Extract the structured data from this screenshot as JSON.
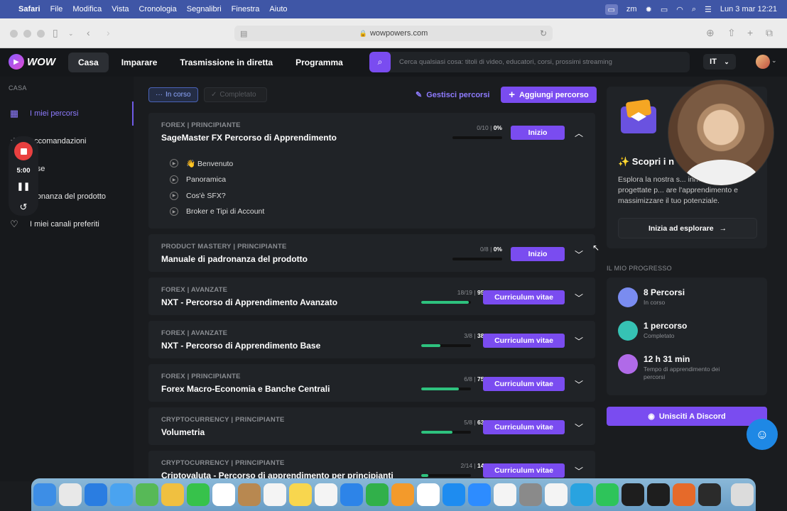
{
  "menubar": {
    "app": "Safari",
    "items": [
      "File",
      "Modifica",
      "Vista",
      "Cronologia",
      "Segnalibri",
      "Finestra",
      "Aiuto"
    ],
    "datetime": "Lun 3 mar  12:21"
  },
  "browser": {
    "url": "wowpowers.com"
  },
  "header": {
    "logo": "WOW",
    "nav": [
      "Casa",
      "Imparare",
      "Trasmissione in diretta",
      "Programma"
    ],
    "search_placeholder": "Cerca qualsiasi cosa: titoli di video, educatori, corsi, prossimi streaming",
    "language": "IT"
  },
  "sidebar": {
    "section": "CASA",
    "items": [
      {
        "label": "I miei percorsi",
        "icon": "paths-icon"
      },
      {
        "label": "accomandazioni",
        "icon": "star-icon"
      },
      {
        "label": "orse",
        "icon": "book-icon"
      },
      {
        "label": "dronanza del prodotto",
        "icon": "box-icon"
      },
      {
        "label": "I miei canali preferiti",
        "icon": "heart-icon"
      }
    ]
  },
  "recorder": {
    "time": "5:00"
  },
  "main": {
    "filters": [
      "In corso",
      "Completato"
    ],
    "manage": "Gestisci percorsi",
    "add": "Aggiungi percorso",
    "courses": [
      {
        "category": "FOREX | PRINCIPIANTE",
        "title": "SageMaster FX Percorso di Apprendimento",
        "done": "0/10",
        "percent": "0%",
        "progress": 0,
        "button": "Inizio",
        "expanded": true,
        "lessons": [
          "👋 Benvenuto",
          "Panoramica",
          "Cos'è SFX?",
          "Broker e Tipi di Account"
        ]
      },
      {
        "category": "PRODUCT MASTERY | PRINCIPIANTE",
        "title": "Manuale di padronanza del prodotto",
        "done": "0/8",
        "percent": "0%",
        "progress": 0,
        "button": "Inizio"
      },
      {
        "category": "FOREX | AVANZATE",
        "title": "NXT - Percorso di Apprendimento Avanzato",
        "done": "18/19",
        "percent": "95%",
        "progress": 95,
        "button": "Curriculum vitae"
      },
      {
        "category": "FOREX | AVANZATE",
        "title": "NXT - Percorso di Apprendimento Base",
        "done": "3/8",
        "percent": "38%",
        "progress": 38,
        "button": "Curriculum vitae"
      },
      {
        "category": "FOREX | PRINCIPIANTE",
        "title": "Forex Macro-Economia e Banche Centrali",
        "done": "6/8",
        "percent": "75%",
        "progress": 75,
        "button": "Curriculum vitae"
      },
      {
        "category": "CRYPTOCURRENCY | PRINCIPIANTE",
        "title": "Volumetria",
        "done": "5/8",
        "percent": "63%",
        "progress": 63,
        "button": "Curriculum vitae"
      },
      {
        "category": "CRYPTOCURRENCY | PRINCIPIANTE",
        "title": "Criptovaluta - Percorso di apprendimento per principianti",
        "done": "2/14",
        "percent": "14%",
        "progress": 14,
        "button": "Curriculum vitae"
      }
    ]
  },
  "right": {
    "discover_title": "✨ Scopri i n",
    "discover_desc": "Esplora la nostra s... innovative progettate p... are l'apprendimento e massimizzare il tuo potenziale.",
    "discover_cta": "Inizia ad esplorare",
    "progress_label": "IL MIO PROGRESSO",
    "stats": [
      {
        "value": "8 Percorsi",
        "label": "In corso",
        "color": "#7a8cf0"
      },
      {
        "value": "1 percorso",
        "label": "Completato",
        "color": "#36c2b4"
      },
      {
        "value": "12 h  31 min",
        "label": "Tempo di apprendimento dei percorsi",
        "color": "#b06ae8"
      }
    ],
    "discord": "Unisciti A Discord"
  },
  "dock": {
    "apps": [
      {
        "name": "Finder",
        "color": "#3d8ee6"
      },
      {
        "name": "Launchpad",
        "color": "#e8e8e8"
      },
      {
        "name": "Safari",
        "color": "#2a7de1"
      },
      {
        "name": "Mail",
        "color": "#4aa3f0"
      },
      {
        "name": "Maps",
        "color": "#57b957"
      },
      {
        "name": "Photos",
        "color": "#f0c040"
      },
      {
        "name": "FaceTime",
        "color": "#37c24b"
      },
      {
        "name": "Calendar",
        "color": "#ffffff"
      },
      {
        "name": "Contacts",
        "color": "#b88850"
      },
      {
        "name": "Reminders",
        "color": "#f4f4f4"
      },
      {
        "name": "Notes",
        "color": "#f8d64e"
      },
      {
        "name": "Freeform",
        "color": "#f4f4f4"
      },
      {
        "name": "Keynote",
        "color": "#2d84e8"
      },
      {
        "name": "Numbers",
        "color": "#31b04a"
      },
      {
        "name": "Pages",
        "color": "#f39a2b"
      },
      {
        "name": "Notion",
        "color": "#ffffff"
      },
      {
        "name": "App Store",
        "color": "#1e8cf0"
      },
      {
        "name": "Zoom",
        "color": "#2d8cff"
      },
      {
        "name": "Script",
        "color": "#f4f4f4"
      },
      {
        "name": "Settings",
        "color": "#8a8a8a"
      },
      {
        "name": "ChatGPT",
        "color": "#f4f4f4"
      },
      {
        "name": "Telegram",
        "color": "#29a3e0"
      },
      {
        "name": "WhatsApp",
        "color": "#2ec45a"
      },
      {
        "name": "Skype",
        "color": "#1e1e1e"
      },
      {
        "name": "Spark",
        "color": "#1e1e1e"
      },
      {
        "name": "Firefox",
        "color": "#e66a2a"
      },
      {
        "name": "OBS",
        "color": "#2b2b2b"
      },
      {
        "name": "Trash",
        "color": "#dcdcdc"
      }
    ]
  }
}
